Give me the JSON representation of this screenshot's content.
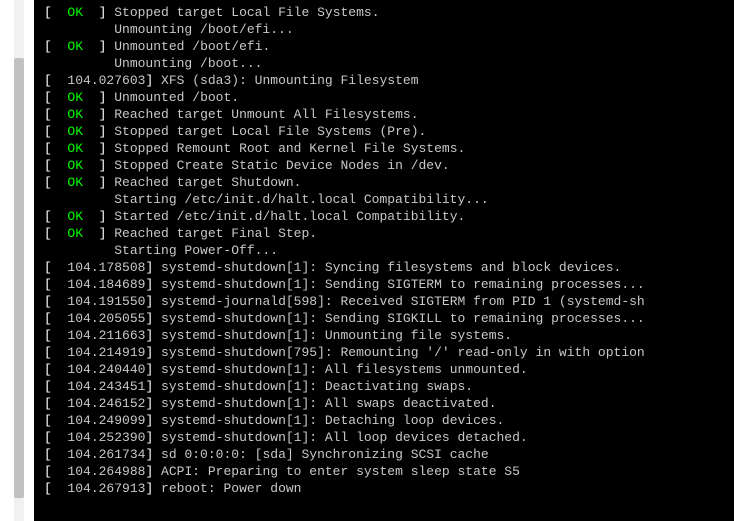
{
  "console": {
    "lines": [
      {
        "type": "ok",
        "text": "Stopped target Local File Systems."
      },
      {
        "type": "plain",
        "text": "Unmounting /boot/efi..."
      },
      {
        "type": "ok",
        "text": "Unmounted /boot/efi."
      },
      {
        "type": "plain",
        "text": "Unmounting /boot..."
      },
      {
        "type": "ts",
        "ts": "104.027603",
        "text": "XFS (sda3): Unmounting Filesystem"
      },
      {
        "type": "ok",
        "text": "Unmounted /boot."
      },
      {
        "type": "ok",
        "text": "Reached target Unmount All Filesystems."
      },
      {
        "type": "ok",
        "text": "Stopped target Local File Systems (Pre)."
      },
      {
        "type": "ok",
        "text": "Stopped Remount Root and Kernel File Systems."
      },
      {
        "type": "ok",
        "text": "Stopped Create Static Device Nodes in /dev."
      },
      {
        "type": "ok",
        "text": "Reached target Shutdown."
      },
      {
        "type": "plain",
        "text": "Starting /etc/init.d/halt.local Compatibility..."
      },
      {
        "type": "ok",
        "text": "Started /etc/init.d/halt.local Compatibility."
      },
      {
        "type": "ok",
        "text": "Reached target Final Step."
      },
      {
        "type": "plain",
        "text": "Starting Power-Off..."
      },
      {
        "type": "ts",
        "ts": "104.178508",
        "text": "systemd-shutdown[1]: Syncing filesystems and block devices."
      },
      {
        "type": "ts",
        "ts": "104.184689",
        "text": "systemd-shutdown[1]: Sending SIGTERM to remaining processes..."
      },
      {
        "type": "ts",
        "ts": "104.191550",
        "text": "systemd-journald[598]: Received SIGTERM from PID 1 (systemd-sh"
      },
      {
        "type": "ts",
        "ts": "104.205055",
        "text": "systemd-shutdown[1]: Sending SIGKILL to remaining processes..."
      },
      {
        "type": "ts",
        "ts": "104.211663",
        "text": "systemd-shutdown[1]: Unmounting file systems."
      },
      {
        "type": "ts",
        "ts": "104.214919",
        "text": "systemd-shutdown[795]: Remounting '/' read-only in with option"
      },
      {
        "type": "ts",
        "ts": "104.240440",
        "text": "systemd-shutdown[1]: All filesystems unmounted."
      },
      {
        "type": "ts",
        "ts": "104.243451",
        "text": "systemd-shutdown[1]: Deactivating swaps."
      },
      {
        "type": "ts",
        "ts": "104.246152",
        "text": "systemd-shutdown[1]: All swaps deactivated."
      },
      {
        "type": "ts",
        "ts": "104.249099",
        "text": "systemd-shutdown[1]: Detaching loop devices."
      },
      {
        "type": "ts",
        "ts": "104.252390",
        "text": "systemd-shutdown[1]: All loop devices detached."
      },
      {
        "type": "ts",
        "ts": "104.261734",
        "text": "sd 0:0:0:0: [sda] Synchronizing SCSI cache"
      },
      {
        "type": "ts",
        "ts": "104.264988",
        "text": "ACPI: Preparing to enter system sleep state S5"
      },
      {
        "type": "ts",
        "ts": "104.267913",
        "text": "reboot: Power down"
      }
    ],
    "ok_label": "OK"
  }
}
